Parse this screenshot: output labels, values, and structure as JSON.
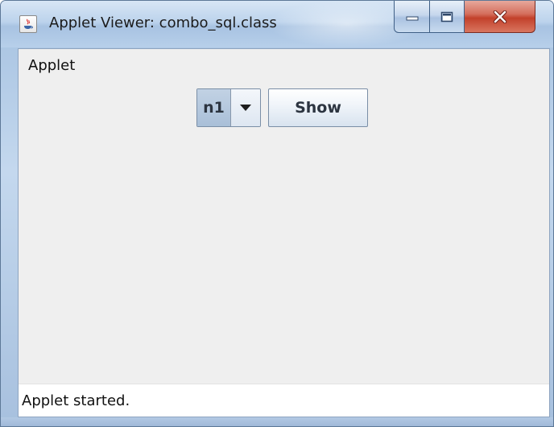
{
  "window": {
    "title": "Applet Viewer: combo_sql.class",
    "icon": "java-icon",
    "controls": {
      "minimize": "minimize-icon",
      "maximize": "maximize-icon",
      "close": "close-icon"
    }
  },
  "menu": {
    "applet_label": "Applet"
  },
  "applet": {
    "combo": {
      "selected": "n1",
      "arrow_icon": "chevron-down-icon"
    },
    "show_label": "Show"
  },
  "status": {
    "text": "Applet started."
  },
  "colors": {
    "close": "#c2412b",
    "frame": "#a9c4e2",
    "client_bg": "#efefef"
  }
}
